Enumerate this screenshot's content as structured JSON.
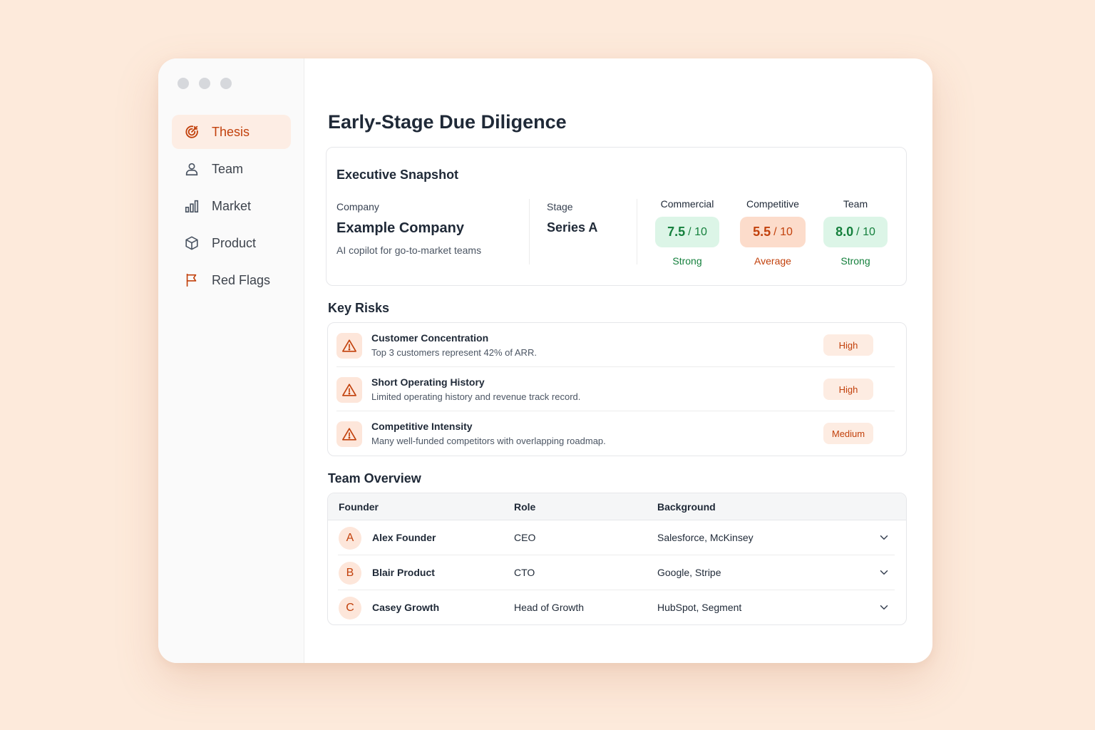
{
  "colors": {
    "accent": "#c2410c",
    "good": "#15803d",
    "background": "#fdeadb"
  },
  "sidebar": {
    "items": [
      {
        "label": "Thesis",
        "icon": "target-icon",
        "active": true
      },
      {
        "label": "Team",
        "icon": "user-icon"
      },
      {
        "label": "Market",
        "icon": "bar-chart-icon"
      },
      {
        "label": "Product",
        "icon": "box-icon"
      },
      {
        "label": "Red Flags",
        "icon": "flag-icon"
      }
    ]
  },
  "page": {
    "title": "Early-Stage Due Diligence"
  },
  "snapshot": {
    "title": "Executive Snapshot",
    "company_label": "Company",
    "company_name": "Example Company",
    "company_desc": "AI copilot for go-to-market teams",
    "stage_label": "Stage",
    "stage_value": "Series A",
    "scores": [
      {
        "label": "Commercial",
        "value": "7.5",
        "denom": "/ 10",
        "rating": "Strong"
      },
      {
        "label": "Competitive",
        "value": "5.5",
        "denom": "/ 10",
        "rating": "Average"
      },
      {
        "label": "Team",
        "value": "8.0",
        "denom": "/ 10",
        "rating": "Strong"
      }
    ]
  },
  "risks": {
    "title": "Key Risks",
    "items": [
      {
        "title": "Customer Concentration",
        "desc": "Top 3 customers represent 42% of ARR.",
        "level": "High"
      },
      {
        "title": "Short Operating History",
        "desc": "Limited operating history and revenue track record.",
        "level": "High"
      },
      {
        "title": "Competitive Intensity",
        "desc": "Many well-funded competitors with overlapping roadmap.",
        "level": "Medium"
      }
    ]
  },
  "team": {
    "title": "Team Overview",
    "columns": [
      "Founder",
      "Role",
      "Background"
    ],
    "rows": [
      {
        "initial": "A",
        "name": "Alex Founder",
        "role": "CEO",
        "background": "Salesforce, McKinsey"
      },
      {
        "initial": "B",
        "name": "Blair Product",
        "role": "CTO",
        "background": "Google, Stripe"
      },
      {
        "initial": "C",
        "name": "Casey Growth",
        "role": "Head of Growth",
        "background": "HubSpot, Segment"
      }
    ]
  }
}
